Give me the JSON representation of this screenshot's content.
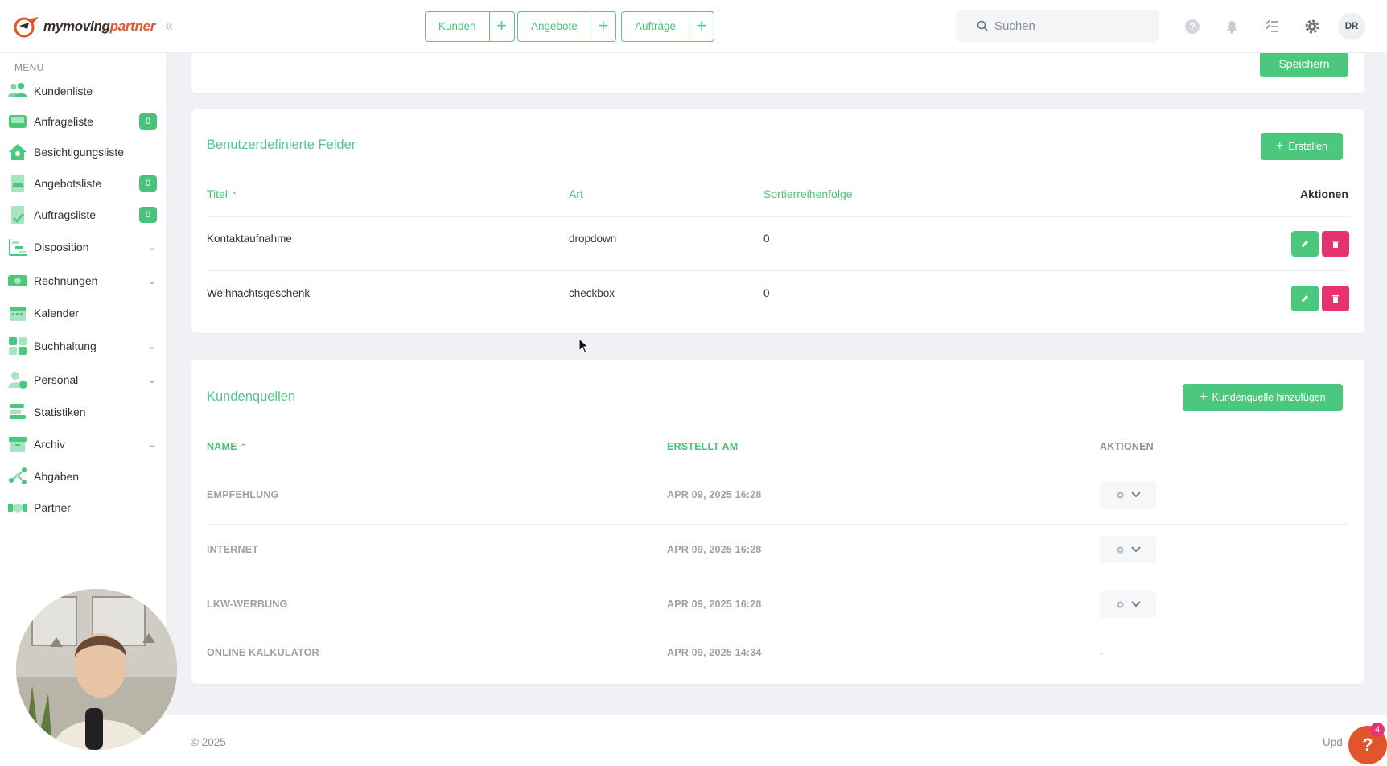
{
  "app": {
    "logo_text_a": "mymoving",
    "logo_text_b": "partner",
    "brand_color": "#e2542b",
    "accent_color": "#4cc77e",
    "danger_color": "#e6336f"
  },
  "topbar": {
    "quick_actions": [
      {
        "label": "Kunden"
      },
      {
        "label": "Angebote"
      },
      {
        "label": "Aufträge"
      }
    ],
    "search_placeholder": "Suchen",
    "icons": [
      "help-icon",
      "bell-icon",
      "checklist-icon",
      "gear-icon"
    ],
    "avatar_initials": "DR"
  },
  "sidebar": {
    "menu_title": "MENU",
    "items": [
      {
        "label": "Kundenliste",
        "icon": "users-icon"
      },
      {
        "label": "Anfrageliste",
        "icon": "inbox-icon",
        "badge": "0"
      },
      {
        "label": "Besichtigungsliste",
        "icon": "house-icon"
      },
      {
        "label": "Angebotsliste",
        "icon": "document-icon",
        "badge": "0"
      },
      {
        "label": "Auftragsliste",
        "icon": "file-check-icon",
        "badge": "0"
      },
      {
        "label": "Disposition",
        "icon": "gantt-icon",
        "expandable": true
      },
      {
        "label": "Rechnungen",
        "icon": "money-icon",
        "expandable": true
      },
      {
        "label": "Kalender",
        "icon": "calendar-icon"
      },
      {
        "label": "Buchhaltung",
        "icon": "grid-icon",
        "expandable": true
      },
      {
        "label": "Personal",
        "icon": "person-clock-icon",
        "expandable": true
      },
      {
        "label": "Statistiken",
        "icon": "bars-icon"
      },
      {
        "label": "Archiv",
        "icon": "archive-icon",
        "expandable": true
      },
      {
        "label": "Abgaben",
        "icon": "network-icon"
      },
      {
        "label": "Partner",
        "icon": "handshake-icon"
      }
    ]
  },
  "top_card": {
    "save_label": "Speichern"
  },
  "custom_fields": {
    "title": "Benutzerdefinierte Felder",
    "create_label": "Erstellen",
    "columns": {
      "title": "Titel",
      "type": "Art",
      "sort": "Sortierreihenfolge",
      "actions": "Aktionen"
    },
    "rows": [
      {
        "title": "Kontaktaufnahme",
        "type": "dropdown",
        "sort": "0"
      },
      {
        "title": "Weihnachtsgeschenk",
        "type": "checkbox",
        "sort": "0"
      }
    ]
  },
  "customer_sources": {
    "title": "Kundenquellen",
    "add_label": "Kundenquelle hinzufügen",
    "columns": {
      "name": "NAME",
      "created": "ERSTELLT AM",
      "actions": "AKTIONEN"
    },
    "rows": [
      {
        "name": "EMPFEHLUNG",
        "created": "APR 09, 2025 16:28",
        "action": "dropdown"
      },
      {
        "name": "INTERNET",
        "created": "APR 09, 2025 16:28",
        "action": "dropdown"
      },
      {
        "name": "LKW-WERBUNG",
        "created": "APR 09, 2025 16:28",
        "action": "dropdown"
      },
      {
        "name": "ONLINE KALKULATOR",
        "created": "APR 09, 2025 14:34",
        "action": "-"
      }
    ]
  },
  "footer": {
    "copyright": "© 2025",
    "update_text": "Upd",
    "help_badge": "4"
  }
}
